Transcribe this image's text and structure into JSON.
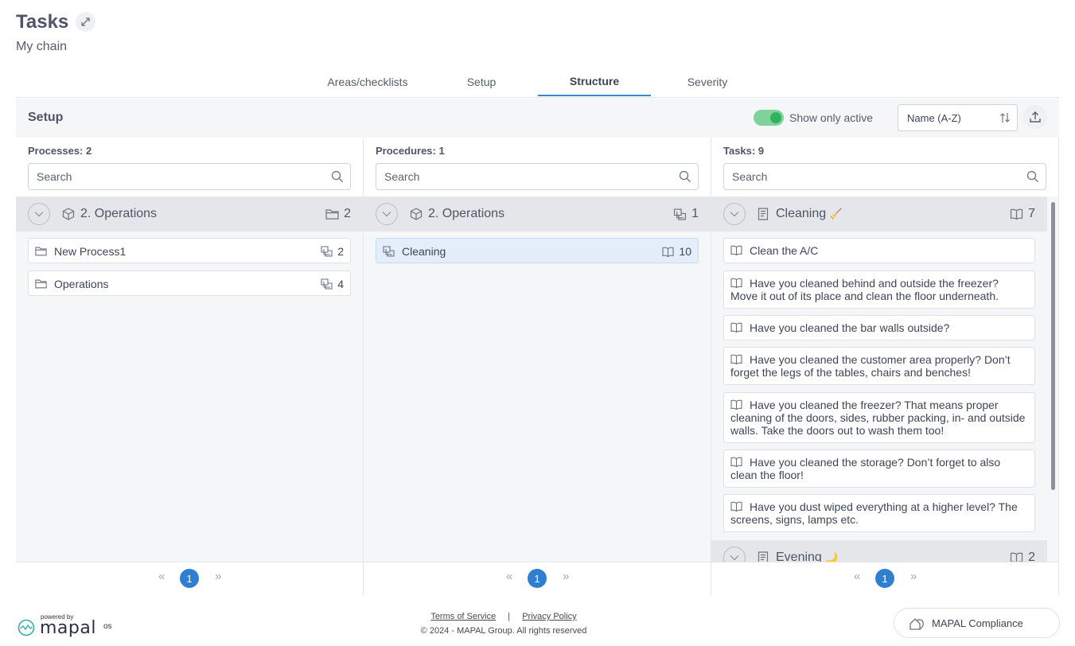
{
  "header": {
    "title": "Tasks",
    "subtitle": "My chain"
  },
  "tabs": [
    {
      "label": "Areas/checklists"
    },
    {
      "label": "Setup"
    },
    {
      "label": "Structure"
    },
    {
      "label": "Severity"
    }
  ],
  "setup_bar": {
    "label": "Setup",
    "show_only_active_label": "Show only active",
    "show_only_active": true,
    "sort_value": "Name (A-Z)"
  },
  "processes": {
    "count_label": "Processes: 2",
    "search_placeholder": "Search",
    "group": {
      "title": "2. Operations",
      "count": "2"
    },
    "items": [
      {
        "label": "New Process1",
        "count": "2"
      },
      {
        "label": "Operations",
        "count": "4"
      }
    ],
    "page": "1"
  },
  "procedures": {
    "count_label": "Procedures: 1",
    "search_placeholder": "Search",
    "group": {
      "title": "2. Operations",
      "count": "1"
    },
    "items": [
      {
        "label": "Cleaning",
        "count": "10"
      }
    ],
    "page": "1"
  },
  "tasks": {
    "count_label": "Tasks: 9",
    "search_placeholder": "Search",
    "group": {
      "title": "Cleaning",
      "emoji": "🧹",
      "count": "7"
    },
    "items": [
      {
        "label": "Clean the A/C"
      },
      {
        "label": "Have you cleaned behind and outside the freezer? Move it out of its place and clean the floor underneath."
      },
      {
        "label": "Have you cleaned the bar walls outside?"
      },
      {
        "label": "Have you cleaned the customer area properly? Don’t forget the legs of the tables, chairs and benches!"
      },
      {
        "label": "Have you cleaned the freezer? That means proper cleaning of the doors, sides, rubber packing, in- and outside walls. Take the doors out to wash them too!"
      },
      {
        "label": "Have you cleaned the storage? Don’t forget to also clean the floor!"
      },
      {
        "label": "Have you dust wiped everything at a higher level? The screens, signs, lamps etc."
      }
    ],
    "group2": {
      "title": "Evening",
      "emoji": "🌙",
      "count": "2"
    },
    "page": "1"
  },
  "pager": {
    "prev": "«",
    "next": "»"
  },
  "footer": {
    "powered_by": "powered by",
    "brand": "mapal",
    "brand_suffix": "os",
    "terms": "Terms of Service",
    "separator": "|",
    "privacy": "Privacy Policy",
    "copyright": "© 2024 - MAPAL Group. All rights reserved",
    "compliance": "MAPAL Compliance"
  }
}
